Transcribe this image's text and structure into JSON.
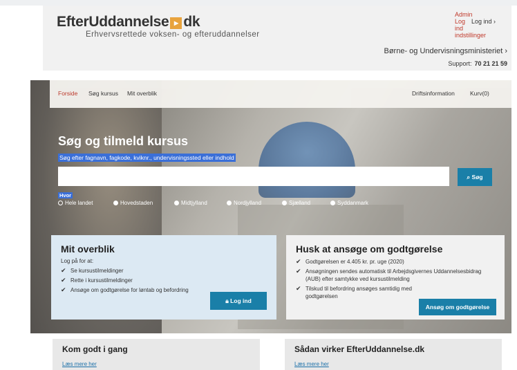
{
  "header": {
    "logo_left": "EfterUddannelse",
    "logo_box": "▸",
    "logo_right": "dk",
    "tagline": "Erhvervsrettede voksen- og efteruddannelser",
    "admin_links": [
      "Admin",
      "Log",
      "ind",
      "indstillinger"
    ],
    "login_label": "Log ind ›",
    "ministry": "Børne- og Undervisningsministeriet ›",
    "support_label": "Support:",
    "support_phone": "70 21 21 59"
  },
  "nav": {
    "items": [
      "Forside",
      "Søg kursus",
      "Mit overblik"
    ],
    "right": [
      "Driftsinformation",
      "Kurv(0)"
    ]
  },
  "search": {
    "title": "Søg og tilmeld kursus",
    "subtitle": "Søg efter fagnavn, fagkode, kviknr., undervisningssted eller indhold",
    "input_value": "",
    "button_label": "Søg",
    "where_label": "Hvor",
    "regions": [
      "Hele landet",
      "Hovedstaden",
      "Midtjylland",
      "Nordjylland",
      "Sjælland",
      "Syddanmark"
    ],
    "selected_region": "Hele landet"
  },
  "overblik": {
    "title": "Mit overblik",
    "lead": "Log på for at:",
    "items": [
      "Se kursustilmeldinger",
      "Rette i kursustilmeldinger",
      "Ansøge om godtgørelse for løntab og befordring"
    ],
    "button_label": "Log ind"
  },
  "godtgoerelse": {
    "title": "Husk at ansøge om godtgørelse",
    "items": [
      "Godtgørelsen er 4.405 kr. pr. uge (2020)",
      "Ansøgningen sendes automatisk til Arbejdsgivernes Uddannelsesbidrag (AUB) efter samtykke ved kursustilmelding",
      "Tilskud til befordring ansøges samtidig med godtgørelsen"
    ],
    "button_label": "Ansøg om godtgørelse"
  },
  "bottom": {
    "left_title": "Kom godt i gang",
    "left_link": "Læs mere her",
    "right_title": "Sådan virker EfterUddannelse.dk",
    "right_link": "Læs mere her"
  },
  "colors": {
    "accent": "#1a7fa8",
    "nav_active": "#c0392b",
    "logo_box": "#e8a33d",
    "card_blue": "#dce9f3"
  }
}
